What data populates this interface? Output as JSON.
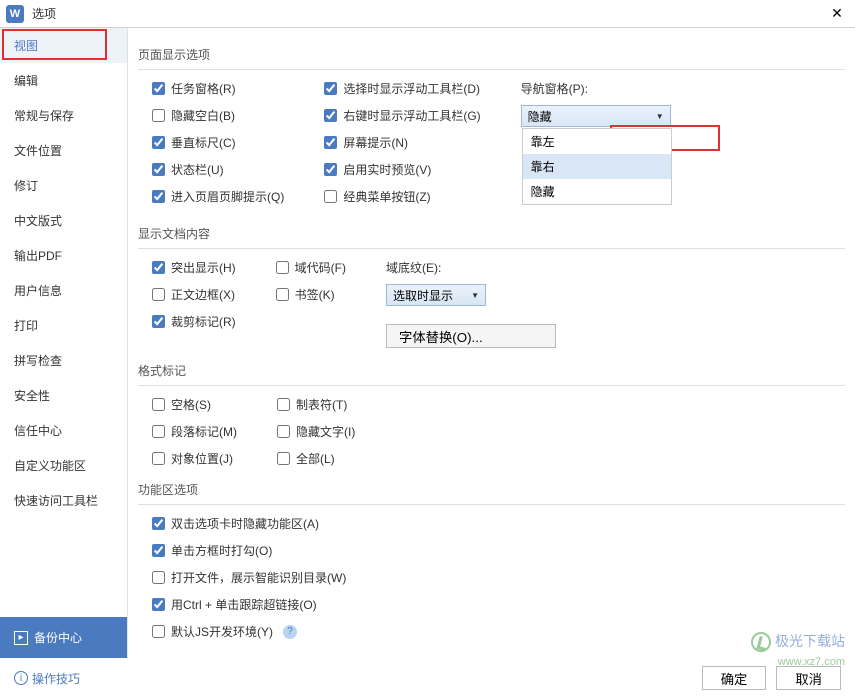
{
  "titlebar": {
    "app_letter": "W",
    "title": "选项"
  },
  "sidebar": {
    "items": [
      "视图",
      "编辑",
      "常规与保存",
      "文件位置",
      "修订",
      "中文版式",
      "输出PDF",
      "用户信息",
      "打印",
      "拼写检查",
      "安全性",
      "信任中心",
      "自定义功能区",
      "快速访问工具栏"
    ],
    "backup": "备份中心"
  },
  "section1": {
    "title": "页面显示选项",
    "col1": [
      "任务窗格(R)",
      "隐藏空白(B)",
      "垂直标尺(C)",
      "状态栏(U)",
      "进入页眉页脚提示(Q)"
    ],
    "col2": [
      "选择时显示浮动工具栏(D)",
      "右键时显示浮动工具栏(G)",
      "屏幕提示(N)",
      "启用实时预览(V)",
      "经典菜单按钮(Z)"
    ],
    "nav_label": "导航窗格(P):",
    "nav_value": "隐藏",
    "nav_options": [
      "靠左",
      "靠右",
      "隐藏"
    ]
  },
  "section2": {
    "title": "显示文档内容",
    "col1": [
      "突出显示(H)",
      "正文边框(X)",
      "裁剪标记(R)"
    ],
    "col2": [
      "域代码(F)",
      "书签(K)"
    ],
    "shade_label": "域底纹(E):",
    "shade_value": "选取时显示",
    "font_btn": "字体替换(O)..."
  },
  "section3": {
    "title": "格式标记",
    "col1": [
      "空格(S)",
      "段落标记(M)",
      "对象位置(J)"
    ],
    "col2": [
      "制表符(T)",
      "隐藏文字(I)",
      "全部(L)"
    ]
  },
  "section4": {
    "title": "功能区选项",
    "items": [
      "双击选项卡时隐藏功能区(A)",
      "单击方框时打勾(O)",
      "打开文件，展示智能识别目录(W)",
      "用Ctrl + 单击跟踪超链接(O)",
      "默认JS开发环境(Y)"
    ]
  },
  "footer": {
    "tips": "操作技巧",
    "ok": "确定",
    "cancel": "取消"
  },
  "watermark": {
    "line1": "极光下载站",
    "line2": "www.xz7.com"
  }
}
